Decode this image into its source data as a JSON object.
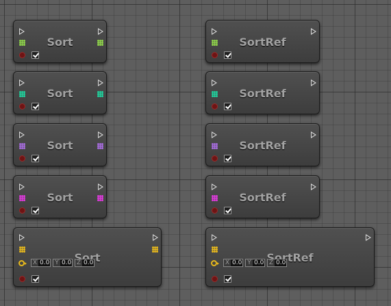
{
  "nodes": [
    {
      "title": "Sort",
      "pin_color": "#8fd44a",
      "outputs": true
    },
    {
      "title": "Sort",
      "pin_color": "#1fd39e",
      "outputs": true
    },
    {
      "title": "Sort",
      "pin_color": "#a86de0",
      "outputs": true
    },
    {
      "title": "Sort",
      "pin_color": "#e23ae0",
      "outputs": true
    },
    {
      "title": "Sort",
      "pin_color": "#e8b91c",
      "outputs": true,
      "vector": {
        "x_label": "X",
        "x": "0.0",
        "y_label": "Y",
        "y": "0.0",
        "z_label": "Z",
        "z": "0.0"
      }
    },
    {
      "title": "SortRef",
      "pin_color": "#8fd44a",
      "outputs": false
    },
    {
      "title": "SortRef",
      "pin_color": "#1fd39e",
      "outputs": false
    },
    {
      "title": "SortRef",
      "pin_color": "#a86de0",
      "outputs": false
    },
    {
      "title": "SortRef",
      "pin_color": "#e23ae0",
      "outputs": false
    },
    {
      "title": "SortRef",
      "pin_color": "#e8b91c",
      "outputs": false,
      "vector": {
        "x_label": "X",
        "x": "0.0",
        "y_label": "Y",
        "y": "0.0",
        "z_label": "Z",
        "z": "0.0"
      }
    }
  ],
  "colors": {
    "exec_pin": "#d8d8d8",
    "delegate_pin": "#6e1414",
    "vector_pin": "#e8b91c"
  }
}
